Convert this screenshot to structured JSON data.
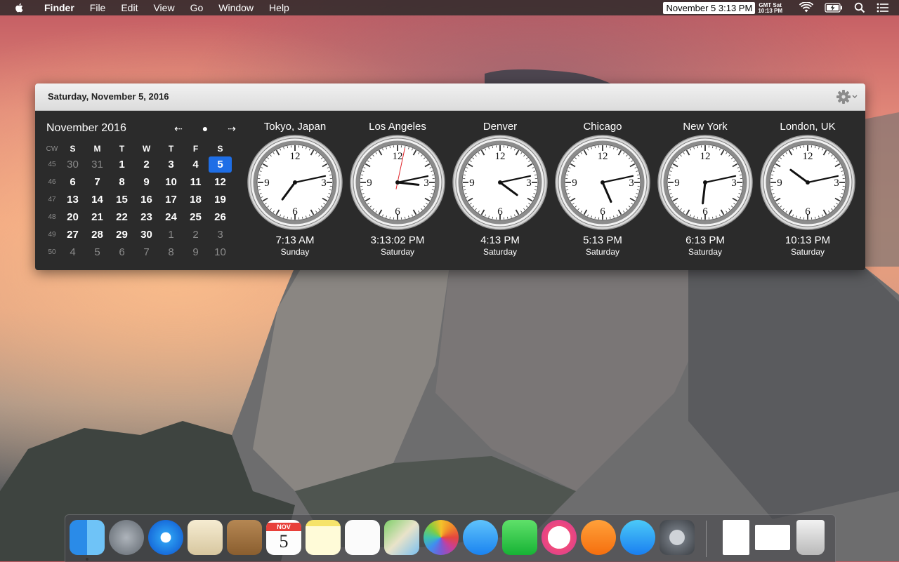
{
  "menubar": {
    "app_name": "Finder",
    "items": [
      "File",
      "Edit",
      "View",
      "Go",
      "Window",
      "Help"
    ],
    "date_time": "November 5  3:13 PM",
    "gmt_label": "GMT Sat",
    "gmt_time": "10:13 PM",
    "icons": [
      "apple-icon",
      "wifi-icon",
      "battery-icon",
      "spotlight-icon",
      "notification-center-icon"
    ]
  },
  "panel": {
    "header_title": "Saturday, November 5, 2016",
    "settings_icon": "gear-icon"
  },
  "calendar": {
    "month_label": "November 2016",
    "nav": {
      "prev": "⇠",
      "today": "●",
      "next": "⇢"
    },
    "week_header": "CW",
    "weekdays": [
      "S",
      "M",
      "T",
      "W",
      "T",
      "F",
      "S"
    ],
    "today": "5",
    "weeks": [
      {
        "cw": "45",
        "days": [
          [
            "30",
            "oth"
          ],
          [
            "31",
            "oth"
          ],
          [
            "1",
            "cur"
          ],
          [
            "2",
            "cur"
          ],
          [
            "3",
            "cur"
          ],
          [
            "4",
            "cur"
          ],
          [
            "5",
            "today"
          ]
        ]
      },
      {
        "cw": "46",
        "days": [
          [
            "6",
            "cur"
          ],
          [
            "7",
            "cur"
          ],
          [
            "8",
            "cur"
          ],
          [
            "9",
            "cur"
          ],
          [
            "10",
            "cur"
          ],
          [
            "11",
            "cur"
          ],
          [
            "12",
            "cur"
          ]
        ]
      },
      {
        "cw": "47",
        "days": [
          [
            "13",
            "cur"
          ],
          [
            "14",
            "cur"
          ],
          [
            "15",
            "cur"
          ],
          [
            "16",
            "cur"
          ],
          [
            "17",
            "cur"
          ],
          [
            "18",
            "cur"
          ],
          [
            "19",
            "cur"
          ]
        ]
      },
      {
        "cw": "48",
        "days": [
          [
            "20",
            "cur"
          ],
          [
            "21",
            "cur"
          ],
          [
            "22",
            "cur"
          ],
          [
            "23",
            "cur"
          ],
          [
            "24",
            "cur"
          ],
          [
            "25",
            "cur"
          ],
          [
            "26",
            "cur"
          ]
        ]
      },
      {
        "cw": "49",
        "days": [
          [
            "27",
            "cur"
          ],
          [
            "28",
            "cur"
          ],
          [
            "29",
            "cur"
          ],
          [
            "30",
            "cur"
          ],
          [
            "1",
            "oth"
          ],
          [
            "2",
            "oth"
          ],
          [
            "3",
            "oth"
          ]
        ]
      },
      {
        "cw": "50",
        "days": [
          [
            "4",
            "oth"
          ],
          [
            "5",
            "oth"
          ],
          [
            "6",
            "oth"
          ],
          [
            "7",
            "oth"
          ],
          [
            "8",
            "oth"
          ],
          [
            "9",
            "oth"
          ],
          [
            "10",
            "oth"
          ]
        ]
      }
    ]
  },
  "clocks": [
    {
      "city": "Tokyo, Japan",
      "time": "7:13 AM",
      "day": "Sunday",
      "h": 7,
      "m": 13,
      "s": null
    },
    {
      "city": "Los Angeles",
      "time": "3:13:02 PM",
      "day": "Saturday",
      "h": 15,
      "m": 13,
      "s": 2
    },
    {
      "city": "Denver",
      "time": "4:13 PM",
      "day": "Saturday",
      "h": 16,
      "m": 13,
      "s": null
    },
    {
      "city": "Chicago",
      "time": "5:13 PM",
      "day": "Saturday",
      "h": 17,
      "m": 13,
      "s": null
    },
    {
      "city": "New York",
      "time": "6:13 PM",
      "day": "Saturday",
      "h": 18,
      "m": 13,
      "s": null
    },
    {
      "city": "London, UK",
      "time": "10:13 PM",
      "day": "Saturday",
      "h": 22,
      "m": 13,
      "s": null
    }
  ],
  "clock_face": {
    "numerals": [
      "12",
      "3",
      "6",
      "9"
    ]
  },
  "dock": {
    "apps": [
      {
        "name": "finder-icon",
        "running": true
      },
      {
        "name": "launchpad-icon"
      },
      {
        "name": "safari-icon"
      },
      {
        "name": "mail-icon"
      },
      {
        "name": "contacts-icon"
      },
      {
        "name": "calendar-icon",
        "month": "NOV",
        "day": "5"
      },
      {
        "name": "notes-icon"
      },
      {
        "name": "reminders-icon"
      },
      {
        "name": "maps-icon"
      },
      {
        "name": "photos-icon"
      },
      {
        "name": "messages-icon"
      },
      {
        "name": "facetime-icon"
      },
      {
        "name": "itunes-icon"
      },
      {
        "name": "ibooks-icon"
      },
      {
        "name": "app-store-icon"
      },
      {
        "name": "system-preferences-icon"
      },
      {
        "name": "document-icon"
      },
      {
        "name": "screenshot-icon"
      },
      {
        "name": "trash-icon"
      }
    ]
  },
  "colors": {
    "accent": "#1e6ee6",
    "panel_bg": "#2b2b2b",
    "second_hand": "#e0242a"
  }
}
